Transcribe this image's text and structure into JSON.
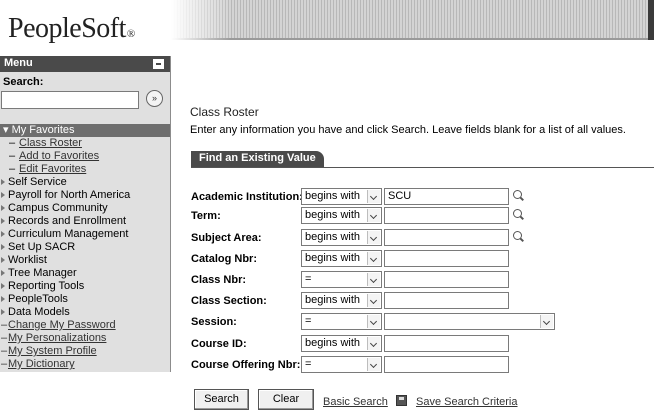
{
  "logo": {
    "text": "PeopleSoft",
    "mark": "®"
  },
  "menu": {
    "title": "Menu",
    "search_label": "Search:",
    "search_value": "",
    "search_go_glyph": "»",
    "favorites_label": "My Favorites",
    "favorites": [
      "Class Roster",
      "Add to Favorites",
      "Edit Favorites"
    ],
    "nav": [
      "Self Service",
      "Payroll for North America",
      "Campus Community",
      "Records and Enrollment",
      "Curriculum Management",
      "Set Up SACR",
      "Worklist",
      "Tree Manager",
      "Reporting Tools",
      "PeopleTools",
      "Data Models"
    ],
    "links": [
      "Change My Password",
      "My Personalizations",
      "My System Profile",
      "My Dictionary"
    ]
  },
  "page": {
    "title": "Class Roster",
    "instructions": "Enter any information you have and click Search. Leave fields blank for a list of all values.",
    "tab": "Find an Existing Value"
  },
  "fields": [
    {
      "label": "Academic Institution:",
      "operator": "begins with",
      "value": "SCU",
      "lookup": true
    },
    {
      "label": "Term:",
      "operator": "begins with",
      "value": "",
      "lookup": true
    },
    {
      "label": "Subject Area:",
      "operator": "begins with",
      "value": "",
      "lookup": true
    },
    {
      "label": "Catalog Nbr:",
      "operator": "begins with",
      "value": "",
      "lookup": false
    },
    {
      "label": "Class Nbr:",
      "operator": "=",
      "value": "",
      "lookup": false
    },
    {
      "label": "Class Section:",
      "operator": "begins with",
      "value": "",
      "lookup": false
    },
    {
      "label": "Session:",
      "operator": "=",
      "value": "",
      "lookup": false
    },
    {
      "label": "Course ID:",
      "operator": "begins with",
      "value": "",
      "lookup": false
    },
    {
      "label": "Course Offering Nbr:",
      "operator": "=",
      "value": "",
      "lookup": false
    }
  ],
  "actions": {
    "search": "Search",
    "clear": "Clear",
    "basic_search": "Basic Search",
    "save_criteria": "Save Search Criteria"
  },
  "icons": {
    "lookup": "magnifier-icon",
    "save": "floppy-disk-icon",
    "dropdown": "chevron-down-icon",
    "go": "double-chevron-right-icon"
  }
}
